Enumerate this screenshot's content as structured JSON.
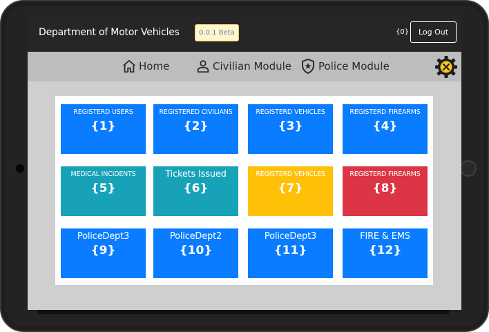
{
  "header": {
    "title": "Department of Motor Vehicles",
    "version": "0.0.1 Beta",
    "count": "{0}",
    "logout_label": "Log Out"
  },
  "nav": {
    "home": "Home",
    "civilian": "Civilian Module",
    "police": "Police Module"
  },
  "colors": {
    "blue": "#0a7cff",
    "teal": "#17a2b8",
    "yellow": "#ffc107",
    "red": "#dc3545"
  },
  "tiles": [
    {
      "label": "REGISTERD USERS",
      "value": "{1}",
      "color": "blue"
    },
    {
      "label": "REGISTERED CIVILIANS",
      "value": "{2}",
      "color": "blue"
    },
    {
      "label": "REGISTERD VEHICLES",
      "value": "{3}",
      "color": "blue"
    },
    {
      "label": "REGISTERD FIREARMS",
      "value": "{4}",
      "color": "blue"
    },
    {
      "label": "MEDICAL INCIDENTS",
      "value": "{5}",
      "color": "teal"
    },
    {
      "label": "Tickets Issued",
      "value": "{6}",
      "color": "teal"
    },
    {
      "label": "REGISTERD VEHICLES",
      "value": "{7}",
      "color": "yellow"
    },
    {
      "label": "REGISTERD FIREARMS",
      "value": "{8}",
      "color": "red"
    },
    {
      "label": "PoliceDept3",
      "value": "{9}",
      "color": "blue"
    },
    {
      "label": "PoliceDept2",
      "value": "{10}",
      "color": "blue"
    },
    {
      "label": "PoliceDept3",
      "value": "{11}",
      "color": "blue"
    },
    {
      "label": "FIRE & EMS",
      "value": "{12}",
      "color": "blue"
    }
  ]
}
